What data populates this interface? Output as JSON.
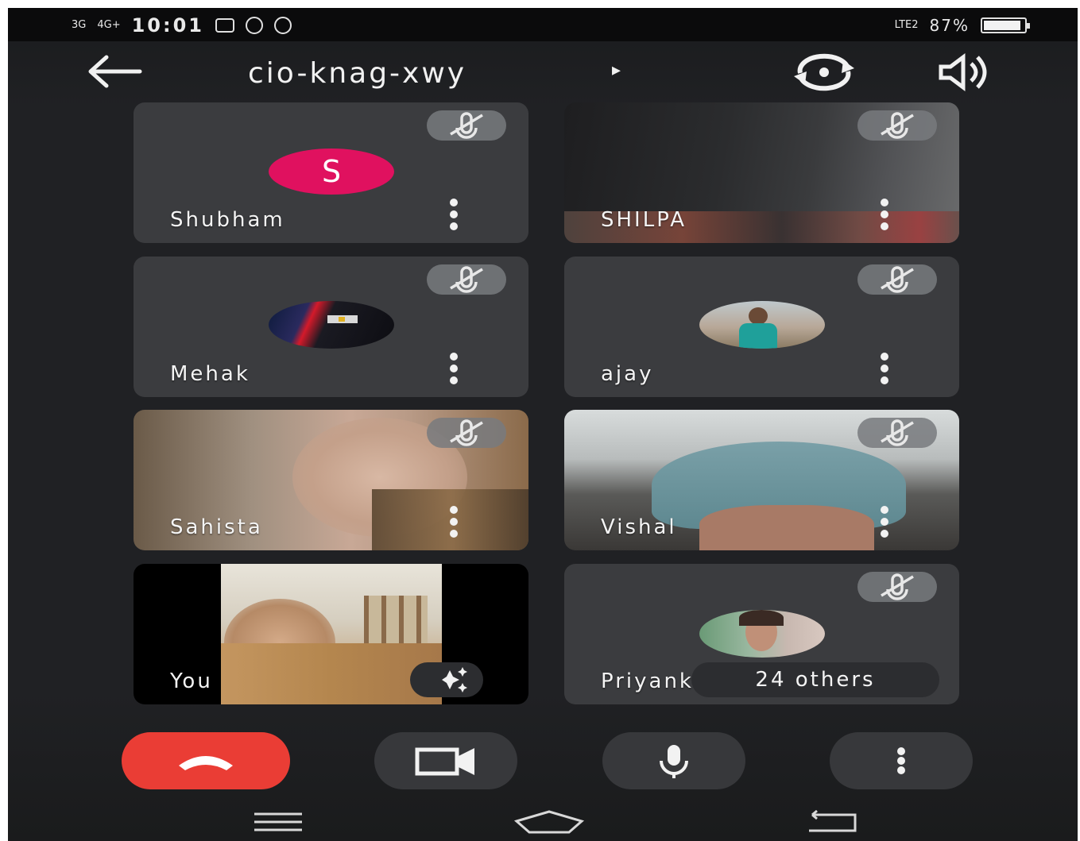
{
  "status_bar": {
    "signal_1": "3G",
    "signal_2": "4G+",
    "time": "10:01",
    "network": "LTE2",
    "battery": "87%"
  },
  "header": {
    "meeting_code": "cio-knag-xwy",
    "caret": "▸"
  },
  "tiles": [
    {
      "name": "Shubham",
      "avatar_letter": "S",
      "muted": true
    },
    {
      "name": "SHILPA",
      "muted": true
    },
    {
      "name": "Mehak",
      "muted": true
    },
    {
      "name": "ajay",
      "muted": true
    },
    {
      "name": "Sahista",
      "muted": true
    },
    {
      "name": "Vishal",
      "muted": true
    },
    {
      "name": "You"
    },
    {
      "name": "Priyanka",
      "muted": true,
      "others_label": "24 others"
    }
  ],
  "icons": {
    "back": "arrow-left-icon",
    "switch_camera": "switch-camera-icon",
    "speaker": "speaker-icon",
    "mute": "mic-off-icon",
    "more": "more-vertical-icon",
    "effects": "sparkle-icon",
    "end_call": "hang-up-icon",
    "camera": "videocam-icon",
    "mic": "mic-icon"
  },
  "colors": {
    "end_call": "#ea3d35",
    "avatar_s": "#e0115f",
    "background": "#202124",
    "tile": "#3b3c3f"
  }
}
